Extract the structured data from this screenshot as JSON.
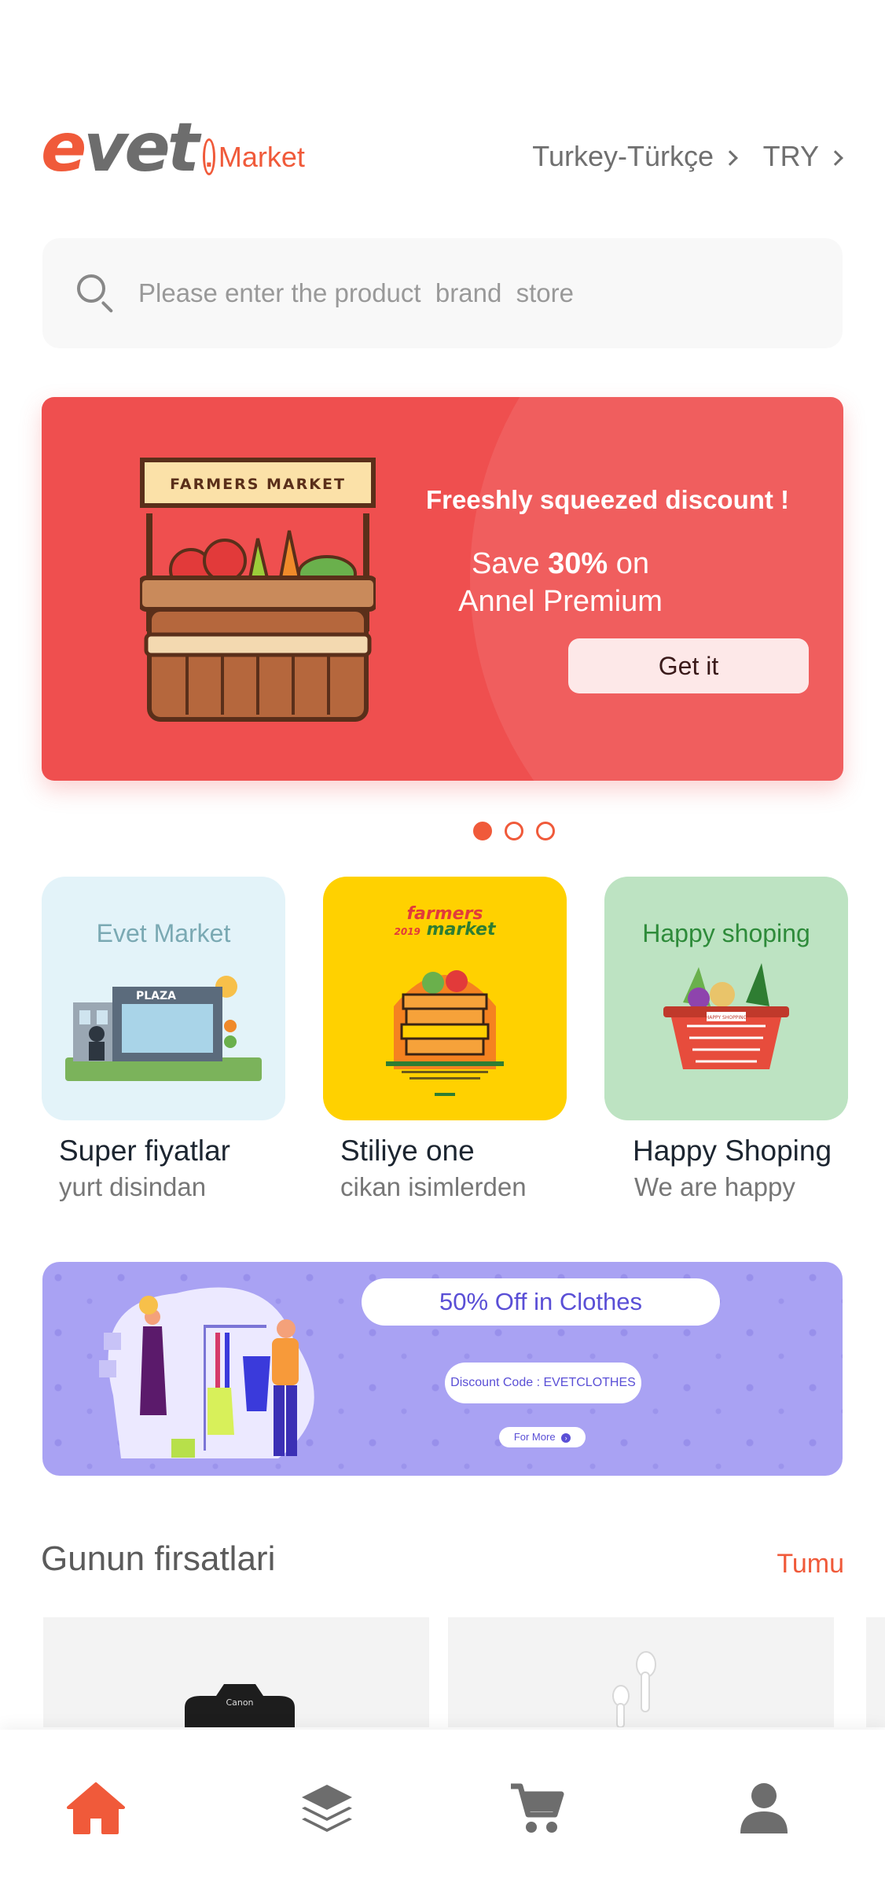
{
  "header": {
    "logo_brand": "evet",
    "logo_suffix": "Market",
    "locale_label": "Turkey-Türkçe",
    "currency_label": "TRY"
  },
  "search": {
    "placeholder": "Please enter the product  brand  store"
  },
  "hero_banner": {
    "stall_sign": "FARMERS MARKET",
    "title": "Freeshly squeezed discount !",
    "save_prefix": "Save ",
    "save_value": "30%",
    "save_suffix": " on",
    "save_line2": "Annel Premium",
    "button_label": "Get it",
    "background_color": "#ef4f4f"
  },
  "carousel": {
    "page_count": 3,
    "active_index": 0
  },
  "categories": [
    {
      "image_label": "Evet Market",
      "building_sign": "PLAZA",
      "title": "Super fiyatlar",
      "subtitle": "yurt disindan",
      "bg": "#e3f3f9"
    },
    {
      "image_label_line1": "farmers",
      "image_label_year": "2019",
      "image_label_line2": "market",
      "title": "Stiliye one",
      "subtitle": "cikan isimlerden",
      "bg": "#ffd100"
    },
    {
      "image_label": "Happy shoping",
      "basket_label": "HAPPY SHOPPING",
      "title": "Happy Shoping",
      "subtitle": "We are happy",
      "bg": "#bde3c2"
    }
  ],
  "promo": {
    "title": "50% Off in Clothes",
    "code": "Discount Code : EVETCLOTHES",
    "more": "For More",
    "background_color": "#a9a2f3"
  },
  "deals": {
    "title": "Gunun firsatlari",
    "see_all": "Tumu",
    "products": [
      {
        "brand_text": "Canon",
        "icon": "camera-icon"
      },
      {
        "icon": "airpods-icon"
      }
    ]
  },
  "bottom_nav": {
    "items": [
      {
        "icon": "home-icon",
        "active": true
      },
      {
        "icon": "layers-icon",
        "active": false
      },
      {
        "icon": "cart-icon",
        "active": false
      },
      {
        "icon": "profile-icon",
        "active": false
      }
    ],
    "active_color": "#f05a3a",
    "inactive_color": "#6d6d6d"
  }
}
